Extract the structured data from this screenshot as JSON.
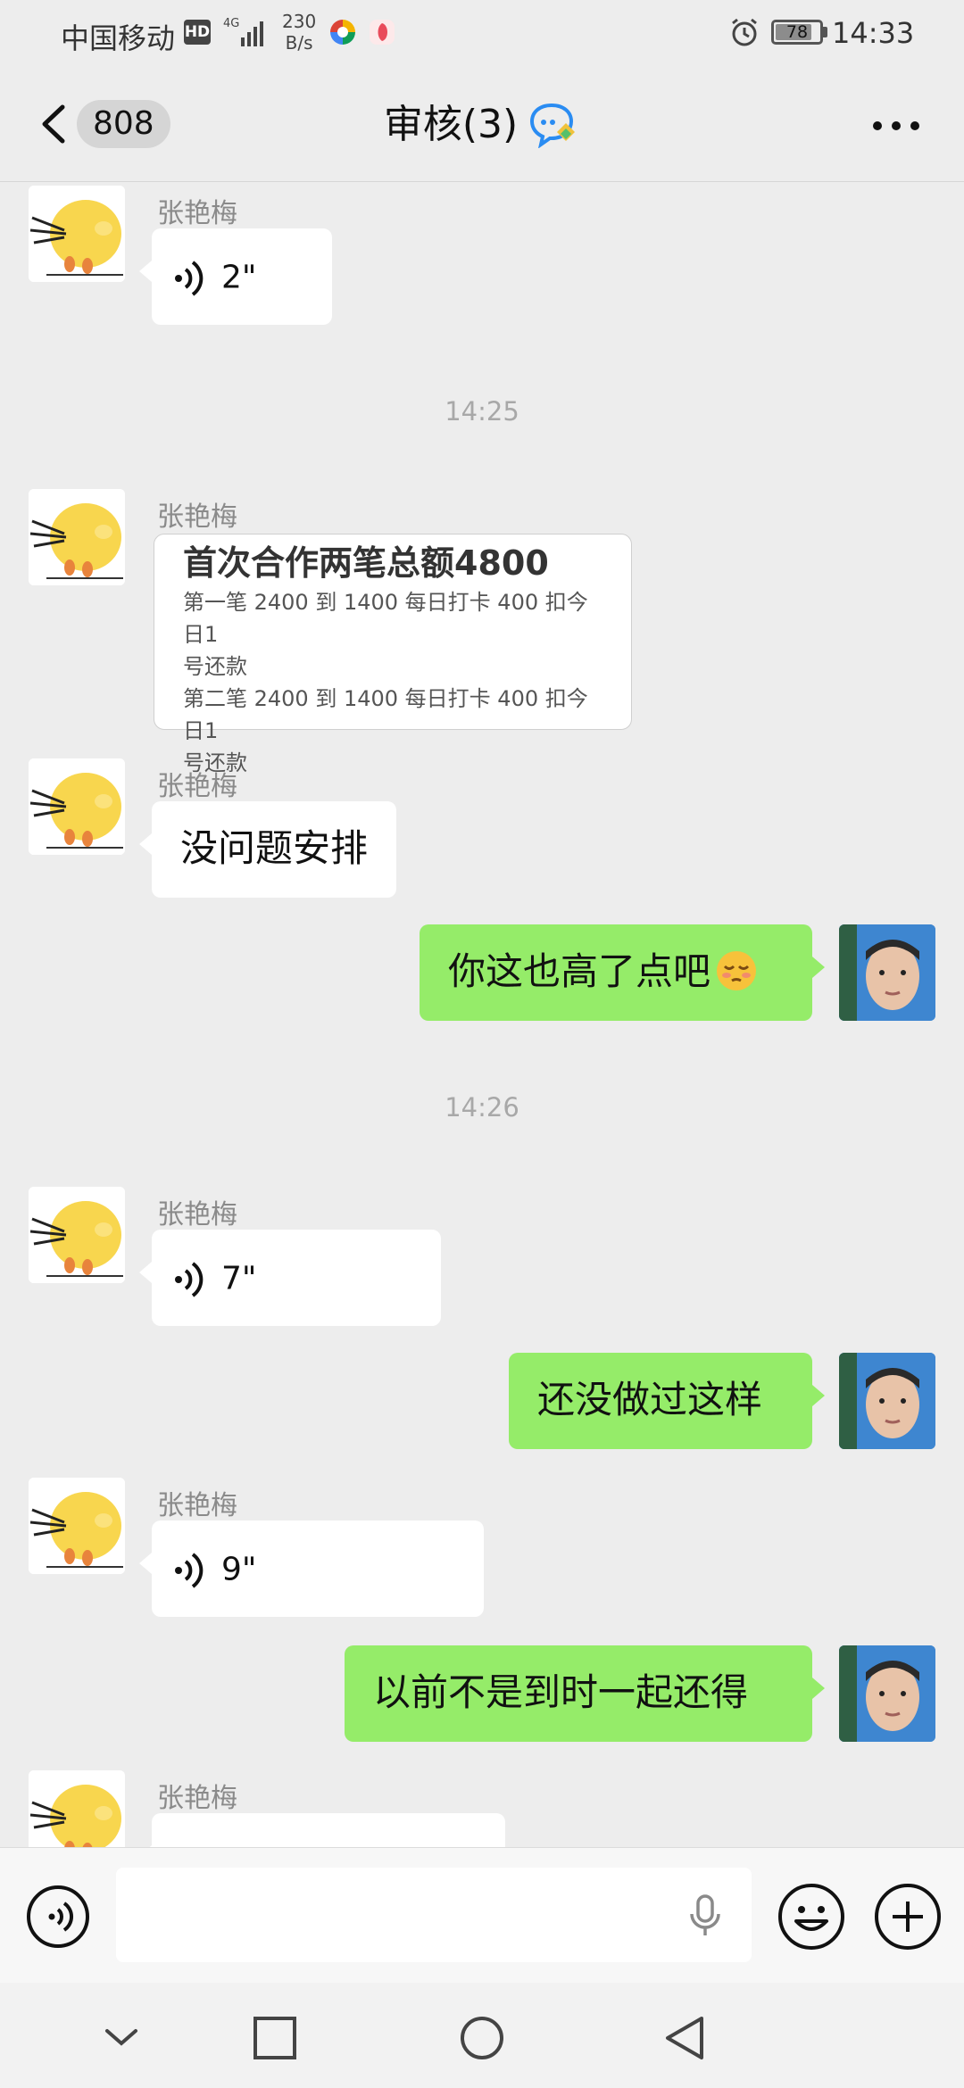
{
  "status_bar": {
    "carrier": "中国移动",
    "hd": "HD",
    "network": "4G",
    "speed_top": "230",
    "speed_bottom": "B/s",
    "battery": "78",
    "time": "14:33"
  },
  "header": {
    "back_count": "808",
    "title": "审核(3)"
  },
  "messages": [
    {
      "sender": "张艳梅",
      "voice_duration": "2\""
    },
    {
      "timestamp": "14:25"
    },
    {
      "sender": "张艳梅",
      "card_title": "首次合作两笔总额4800",
      "card_lines": [
        "第一笔 2400 到 1400 每日打卡 400 扣今日1",
        "号还款",
        "第二笔 2400 到 1400 每日打卡 400 扣今日1",
        "号还款"
      ]
    },
    {
      "sender": "张艳梅",
      "text": "没问题安排"
    },
    {
      "self_text": "你这也高了点吧"
    },
    {
      "timestamp": "14:26"
    },
    {
      "sender": "张艳梅",
      "voice_duration": "7\""
    },
    {
      "self_text": "还没做过这样"
    },
    {
      "sender": "张艳梅",
      "voice_duration": "9\""
    },
    {
      "self_text": "以前不是到时一起还得"
    },
    {
      "sender": "张艳梅"
    }
  ],
  "icons": {
    "back": "chevron-left-icon",
    "group_chat": "chat-bubbles-icon",
    "more": "more-dots-icon",
    "voice_toggle": "voice-icon",
    "mic": "microphone-icon",
    "emoji": "emoji-icon",
    "plus": "plus-icon",
    "nav_down": "chevron-down-icon",
    "nav_recent": "square-icon",
    "nav_home": "circle-icon",
    "nav_back": "triangle-back-icon"
  },
  "colors": {
    "background": "#ededed",
    "self_bubble": "#95ec69",
    "other_bubble": "#ffffff"
  }
}
